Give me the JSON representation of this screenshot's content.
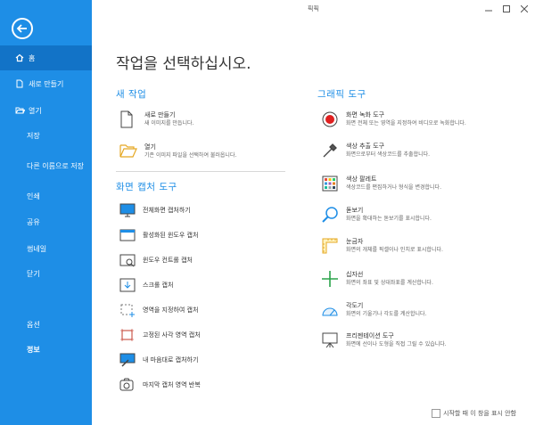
{
  "window": {
    "title": "픽픽"
  },
  "sidebar": {
    "items": [
      {
        "label": "홈",
        "icon": "home-icon"
      },
      {
        "label": "새로 만들기",
        "icon": "new-file-icon"
      },
      {
        "label": "열기",
        "icon": "folder-open-icon"
      },
      {
        "label": "저장"
      },
      {
        "label": "다른 이름으로 저장"
      },
      {
        "label": "인쇄"
      },
      {
        "label": "공유"
      },
      {
        "label": "썸네일"
      },
      {
        "label": "닫기"
      },
      {
        "label": "옵션"
      },
      {
        "label": "정보"
      }
    ],
    "accent": "#1e8ee6",
    "active_bg": "#1273c7"
  },
  "main": {
    "heading": "작업을 선택하십시오.",
    "new_section": {
      "title": "새 작업",
      "items": [
        {
          "title": "새로 만들기",
          "desc": "새 이미지를 만듭니다.",
          "icon": "blank-page-icon"
        },
        {
          "title": "열기",
          "desc": "기존 이미지 파일을 선택하여 불러옵니다.",
          "icon": "open-folder-icon"
        }
      ]
    },
    "capture_section": {
      "title": "화면 캡처 도구",
      "items": [
        {
          "label": "전체화면 캡처하기",
          "icon": "fullscreen-capture-icon"
        },
        {
          "label": "활성화된 윈도우 캡처",
          "icon": "active-window-icon"
        },
        {
          "label": "윈도우 컨트롤 캡처",
          "icon": "window-control-icon"
        },
        {
          "label": "스크롤 캡처",
          "icon": "scroll-capture-icon"
        },
        {
          "label": "영역을 지정하여 캡처",
          "icon": "region-capture-icon"
        },
        {
          "label": "고정된 사각 영역 캡처",
          "icon": "fixed-region-icon"
        },
        {
          "label": "내 마음대로 캡처하기",
          "icon": "freehand-capture-icon"
        },
        {
          "label": "마지막 캡처 영역 반복",
          "icon": "repeat-capture-icon"
        }
      ]
    },
    "graphic_section": {
      "title": "그래픽 도구",
      "items": [
        {
          "title": "화면 녹화 도구",
          "desc": "화면 전체 또는 영역을 지정하여 비디오로 녹화합니다.",
          "icon": "record-icon"
        },
        {
          "title": "색상 추출 도구",
          "desc": "화면으로부터 색상코드를 추출합니다.",
          "icon": "eyedropper-icon"
        },
        {
          "title": "색상 팔레트",
          "desc": "색상코드를 편집하거나 형식을 변경합니다.",
          "icon": "palette-icon"
        },
        {
          "title": "돋보기",
          "desc": "화면을 확대하는 돋보기를 표시합니다.",
          "icon": "magnifier-icon"
        },
        {
          "title": "눈금자",
          "desc": "화면의 개체를 픽셀이나 인치로 표시합니다.",
          "icon": "ruler-icon"
        },
        {
          "title": "십자선",
          "desc": "화면의 좌표 및 상대좌표를 계산합니다.",
          "icon": "crosshair-icon"
        },
        {
          "title": "각도기",
          "desc": "화면의 기울기나 각도를 계산합니다.",
          "icon": "protractor-icon"
        },
        {
          "title": "프리젠테이션 도구",
          "desc": "화면에 선이나 도형을 직접 그릴 수 있습니다.",
          "icon": "whiteboard-icon"
        }
      ]
    }
  },
  "footer": {
    "checkbox_label": "시작할 때 이 창을 표시 안함",
    "checked": false
  }
}
